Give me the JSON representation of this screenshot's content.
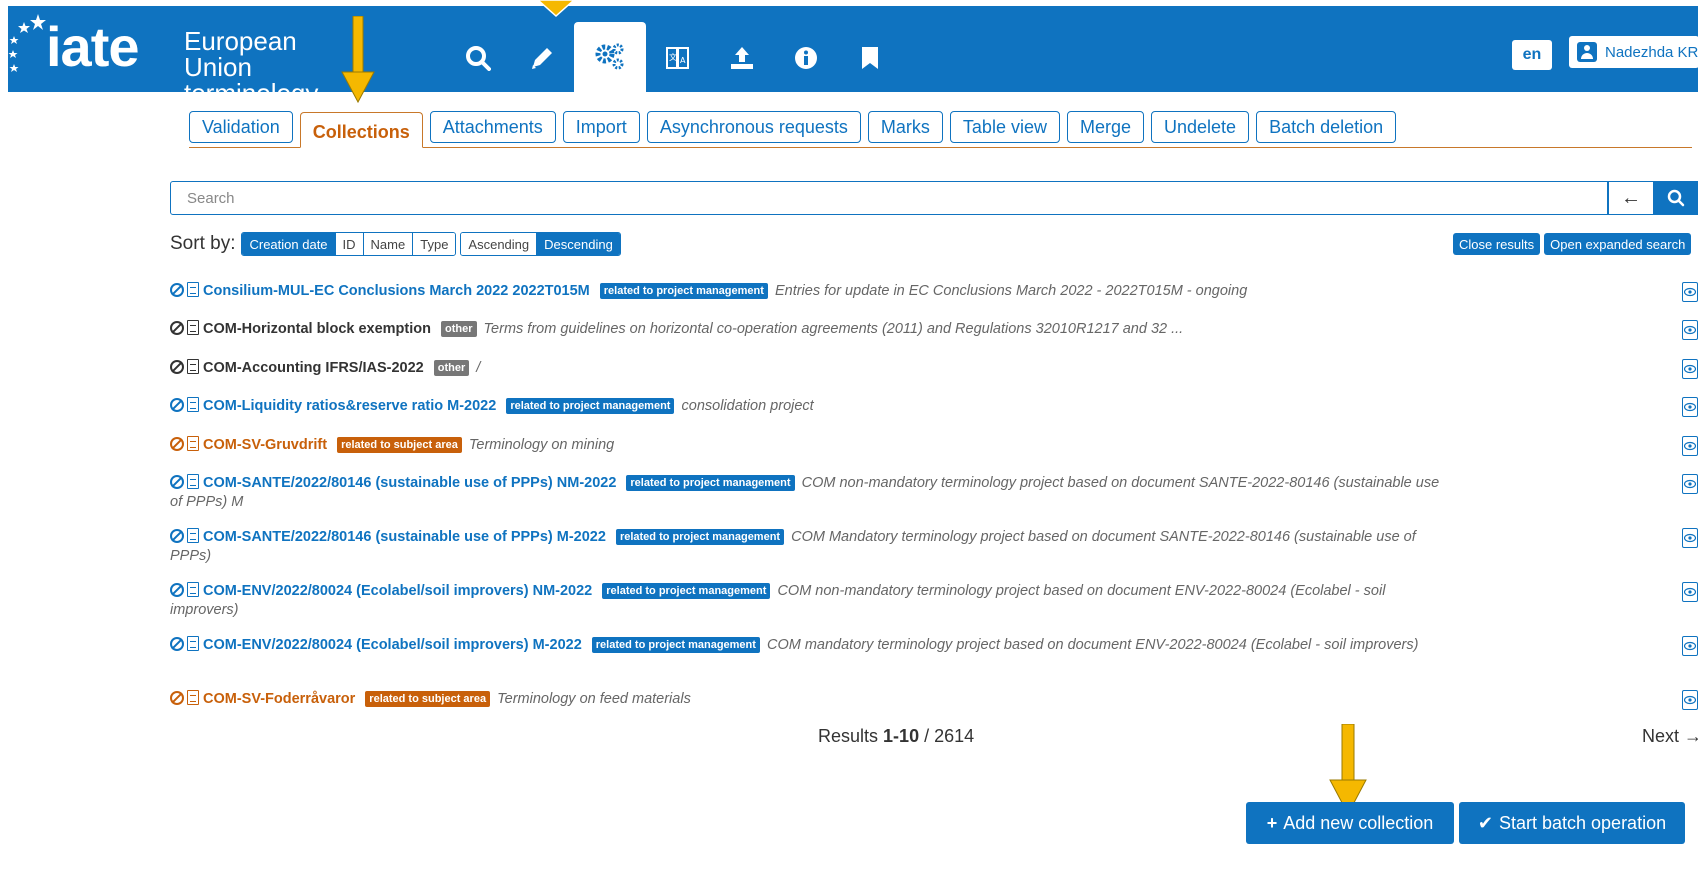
{
  "header": {
    "logo_text": "iate",
    "logo_line1": "European Union",
    "logo_line2": "terminology",
    "language": "en",
    "user": "Nadezhda KRA",
    "nav_icons": [
      "search-icon",
      "pencil-icon",
      "gears-icon",
      "translate-book-icon",
      "upload-icon",
      "info-icon",
      "bookmark-icon"
    ]
  },
  "tabs": [
    "Validation",
    "Collections",
    "Attachments",
    "Import",
    "Asynchronous requests",
    "Marks",
    "Table view",
    "Merge",
    "Undelete",
    "Batch deletion"
  ],
  "active_tab": "Collections",
  "search": {
    "placeholder": "Search"
  },
  "sort": {
    "label": "Sort by:",
    "fields": [
      "Creation date",
      "ID",
      "Name",
      "Type"
    ],
    "active_field": "Creation date",
    "orders": [
      "Ascending",
      "Descending"
    ],
    "active_order": "Descending"
  },
  "result_actions": {
    "close": "Close results",
    "open_expanded": "Open expanded search"
  },
  "items": [
    {
      "title": "Consilium-MUL-EC Conclusions March 2022 2022T015M",
      "badge": "related to project management",
      "desc": "Entries for update in EC Conclusions March 2022 - 2022T015M - ongoing",
      "color": "blue"
    },
    {
      "title": "COM-Horizontal block exemption",
      "badge": "other",
      "desc": "Terms from guidelines on horizontal co-operation agreements (2011) and Regulations 32010R1217 and 32 ...",
      "color": "dark"
    },
    {
      "title": "COM-Accounting IFRS/IAS-2022",
      "badge": "other",
      "desc": "/",
      "color": "dark"
    },
    {
      "title": "COM-Liquidity ratios&reserve ratio M-2022",
      "badge": "related to project management",
      "desc": "consolidation project",
      "color": "blue"
    },
    {
      "title": "COM-SV-Gruvdrift",
      "badge": "related to subject area",
      "desc": "Terminology on mining",
      "color": "orange"
    },
    {
      "title": "COM-SANTE/2022/80146 (sustainable use of PPPs) NM-2022",
      "badge": "related to project management",
      "desc": "COM non-mandatory terminology project based on document SANTE-2022-80146 (sustainable use of PPPs) M",
      "color": "blue"
    },
    {
      "title": "COM-SANTE/2022/80146 (sustainable use of PPPs) M-2022",
      "badge": "related to project management",
      "desc": "COM Mandatory terminology project based on document SANTE-2022-80146 (sustainable use of PPPs)",
      "color": "blue"
    },
    {
      "title": "COM-ENV/2022/80024 (Ecolabel/soil improvers) NM-2022",
      "badge": "related to project management",
      "desc": "COM non-mandatory terminology project based on document ENV-2022-80024 (Ecolabel - soil improvers)",
      "color": "blue"
    },
    {
      "title": "COM-ENV/2022/80024 (Ecolabel/soil improvers) M-2022",
      "badge": "related to project management",
      "desc": "COM mandatory terminology project based on document ENV-2022-80024 (Ecolabel - soil improvers)",
      "color": "blue"
    },
    {
      "title": "COM-SV-Foderråvaror",
      "badge": "related to subject area",
      "desc": "Terminology on feed materials",
      "color": "orange"
    }
  ],
  "pagination": {
    "results_label": "Results",
    "range": "1-10",
    "separator": "/",
    "total": "2614",
    "next": "Next"
  },
  "actions": {
    "add_collection": "Add new collection",
    "start_batch": "Start batch operation"
  },
  "colors": {
    "primary": "#0f73c0",
    "accent": "#c8600a",
    "arrow": "#f5b800"
  }
}
